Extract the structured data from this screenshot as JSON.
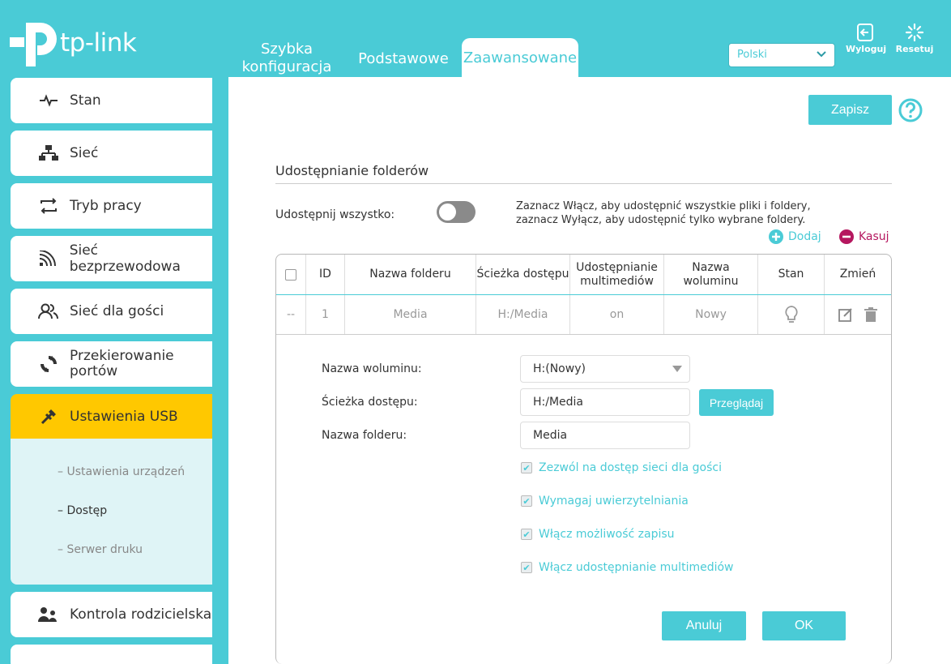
{
  "header": {
    "brand": "tp-link",
    "tabs": [
      {
        "label_line1": "Szybka",
        "label_line2": "konfiguracja"
      },
      {
        "label": "Podstawowe"
      },
      {
        "label": "Zaawansowane",
        "active": true
      }
    ],
    "language": "Polski",
    "logout_label": "Wyloguj",
    "reset_label": "Resetuj"
  },
  "sidebar": {
    "items": [
      {
        "label": "Stan",
        "icon": "pulse-icon"
      },
      {
        "label": "Sieć",
        "icon": "network-icon"
      },
      {
        "label": "Tryb pracy",
        "icon": "swap-arrows-icon"
      },
      {
        "label": "Sieć bezprzewodowa",
        "icon": "wireless-icon"
      },
      {
        "label": "Sieć dla gości",
        "icon": "guests-icon"
      },
      {
        "label_line1": "Przekierowanie",
        "label_line2": "portów",
        "icon": "forwarding-icon"
      },
      {
        "label": "Ustawienia USB",
        "icon": "usb-icon",
        "active": true
      },
      {
        "label": "Kontrola rodzicielska",
        "icon": "parental-icon"
      }
    ],
    "submenu": [
      {
        "label": "– Ustawienia urządzeń"
      },
      {
        "label": "– Dostęp",
        "selected": true
      },
      {
        "label": "– Serwer druku"
      }
    ]
  },
  "main": {
    "save_label": "Zapisz",
    "section_title": "Udostępnianie folderów",
    "share_all_label": "Udostępnij wszystko:",
    "share_all_enabled": false,
    "hint_line1": "Zaznacz Włącz, aby udostępnić wszystkie pliki i foldery,",
    "hint_line2": "zaznacz Wyłącz, aby udostępnić tylko wybrane foldery.",
    "add_label": "Dodaj",
    "delete_label": "Kasuj",
    "table": {
      "headers": {
        "id": "ID",
        "folder": "Nazwa folderu",
        "path": "Ścieżka dostępu",
        "media_line1": "Udostępnianie",
        "media_line2": "multimediów",
        "volume_line1": "Nazwa",
        "volume_line2": "woluminu",
        "status": "Stan",
        "edit": "Zmień"
      },
      "rows": [
        {
          "check": "--",
          "id": "1",
          "folder": "Media",
          "path": "H:/Media",
          "media": "on",
          "volume": "Nowy"
        }
      ]
    },
    "form": {
      "volume_label": "Nazwa woluminu:",
      "volume_value": "H:(Nowy)",
      "path_label": "Ścieżka dostępu:",
      "path_value": "H:/Media",
      "browse_label": "Przeglądaj",
      "folder_label": "Nazwa folderu:",
      "folder_value": "Media",
      "options": [
        {
          "label": "Zezwól na dostęp sieci dla gości",
          "checked": true
        },
        {
          "label": "Wymagaj uwierzytelniania",
          "checked": true
        },
        {
          "label": "Włącz możliwość zapisu",
          "checked": true
        },
        {
          "label": "Włącz udostępnianie multimediów",
          "checked": true
        }
      ],
      "cancel_label": "Anuluj",
      "ok_label": "OK"
    }
  },
  "colors": {
    "accent": "#4acbd6",
    "active_menu": "#ffc800",
    "delete": "#b5175f"
  }
}
